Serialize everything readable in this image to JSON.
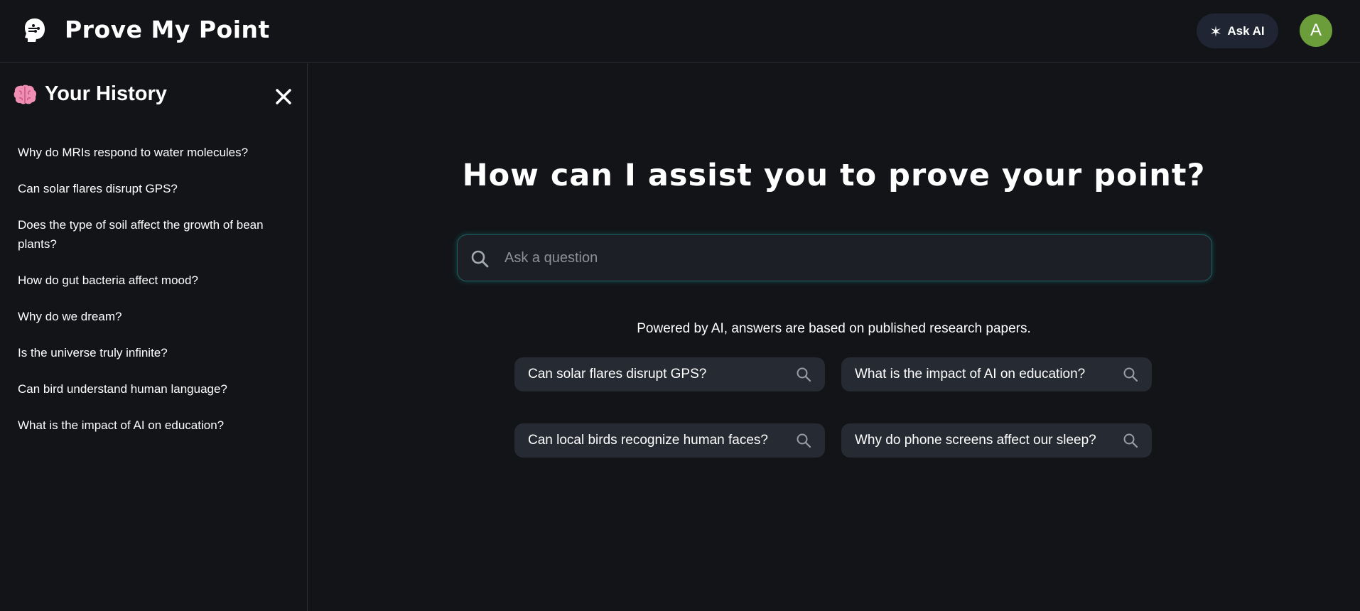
{
  "header": {
    "brand": "Prove My Point",
    "logo_icon": "ai-head-icon",
    "ask_ai_label": "Ask AI",
    "ask_ai_icon": "sparkle-icon",
    "avatar_initial": "A",
    "avatar_color": "#6b9e3a"
  },
  "sidebar": {
    "title": "Your History",
    "title_icon": "brain-icon",
    "close_icon": "close-icon",
    "items": [
      "Why do MRIs respond to water molecules?",
      "Can solar flares disrupt GPS?",
      "Does the type of soil affect the growth of bean plants?",
      "How do gut bacteria affect mood?",
      "Why do we dream?",
      "Is the universe truly infinite?",
      "Can bird understand human language?",
      "What is the impact of AI on education?"
    ]
  },
  "main": {
    "title": "How can I assist you to prove your point?",
    "search": {
      "placeholder": "Ask a question",
      "value": "",
      "icon": "search-icon"
    },
    "powered_text": "Powered by AI, answers are based on published research papers.",
    "suggestions": [
      "Can solar flares disrupt GPS?",
      "What is the impact of AI on education?",
      "Can local birds recognize human faces?",
      "Why do phone screens affect our sleep?"
    ]
  },
  "colors": {
    "background": "#121418",
    "search_glow": "#20b2aa",
    "chip_background": "#262a32",
    "ask_ai_background": "#1f2533"
  }
}
